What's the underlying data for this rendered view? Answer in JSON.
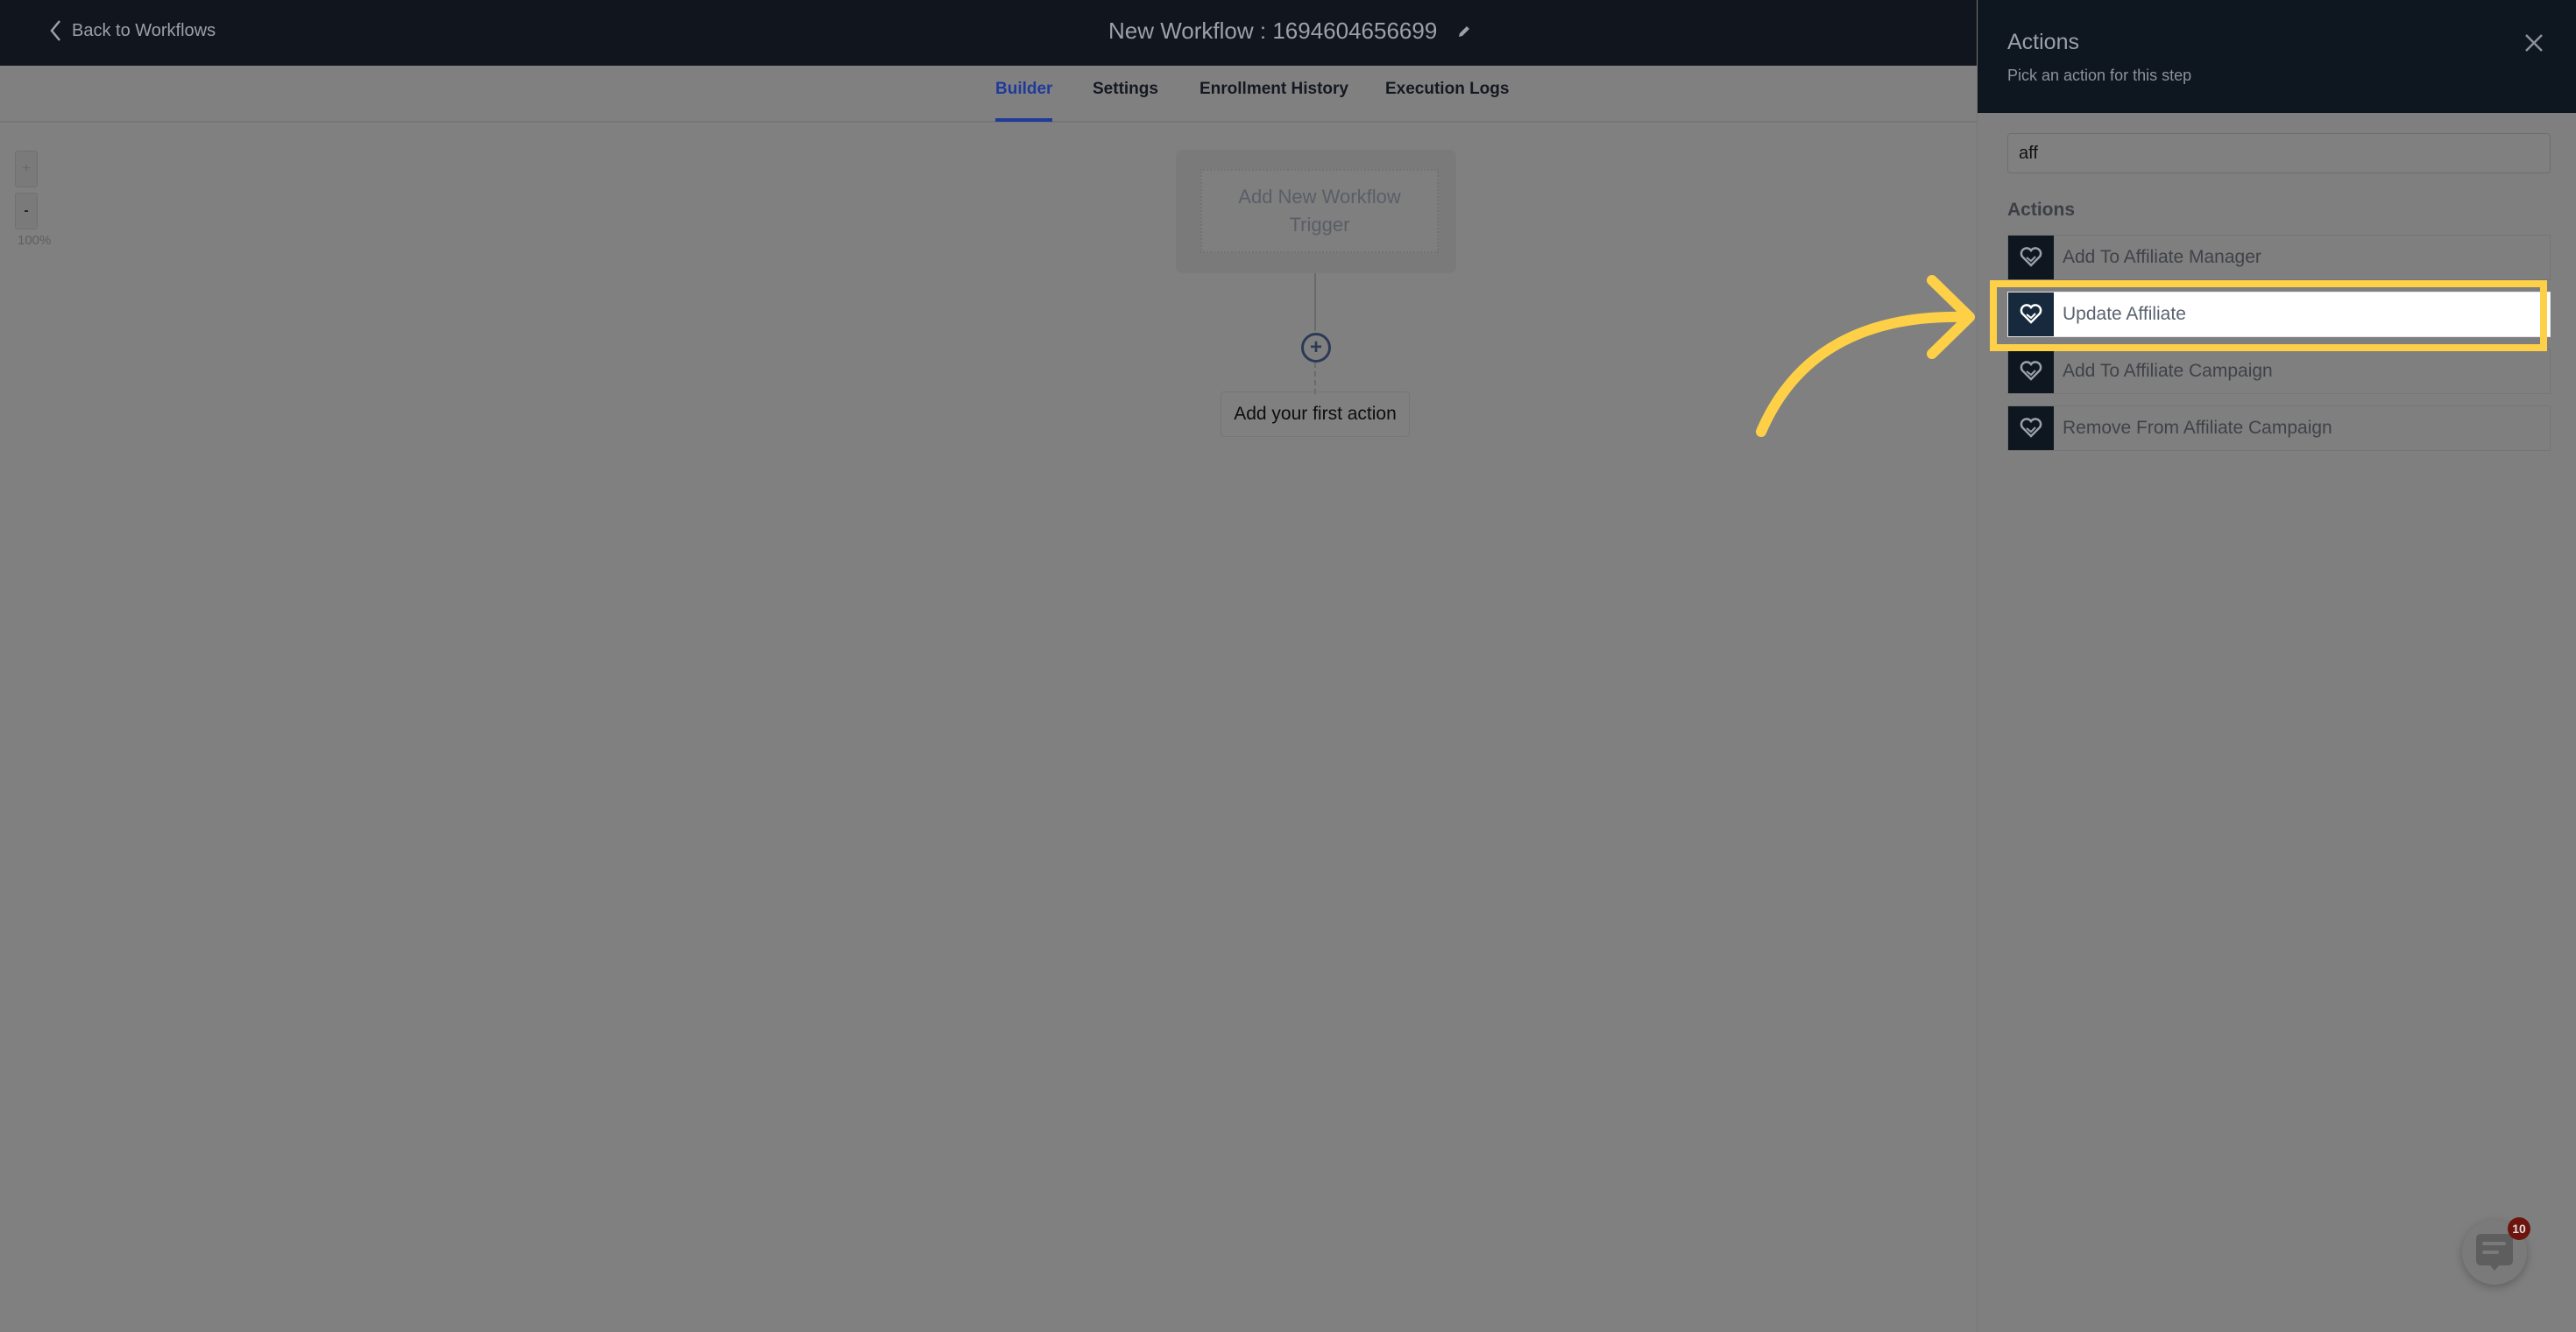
{
  "topbar": {
    "back_label": "Back to Workflows",
    "workflow_title": "New Workflow : 1694604656699"
  },
  "tabs": [
    {
      "label": "Builder",
      "active": true
    },
    {
      "label": "Settings",
      "active": false
    },
    {
      "label": "Enrollment History",
      "active": false
    },
    {
      "label": "Execution Logs",
      "active": false
    }
  ],
  "canvas": {
    "zoom_in": "+",
    "zoom_out": "-",
    "zoom_level": "100%",
    "trigger_label": "Add New Workflow Trigger",
    "first_action_label": "Add your first action"
  },
  "panel": {
    "title": "Actions",
    "subtitle": "Pick an action for this step",
    "search_value": "aff",
    "section_label": "Actions",
    "items": [
      {
        "label": "Add To Affiliate Manager",
        "icon": "handshake-heart-icon"
      },
      {
        "label": "Update Affiliate",
        "icon": "handshake-heart-icon",
        "highlighted": true
      },
      {
        "label": "Add To Affiliate Campaign",
        "icon": "handshake-heart-icon"
      },
      {
        "label": "Remove From Affiliate Campaign",
        "icon": "handshake-heart-icon"
      }
    ]
  },
  "chat": {
    "badge_count": "10"
  },
  "colors": {
    "highlight": "#fdd047",
    "accent": "#1f3a9a",
    "header": "#10151e"
  }
}
